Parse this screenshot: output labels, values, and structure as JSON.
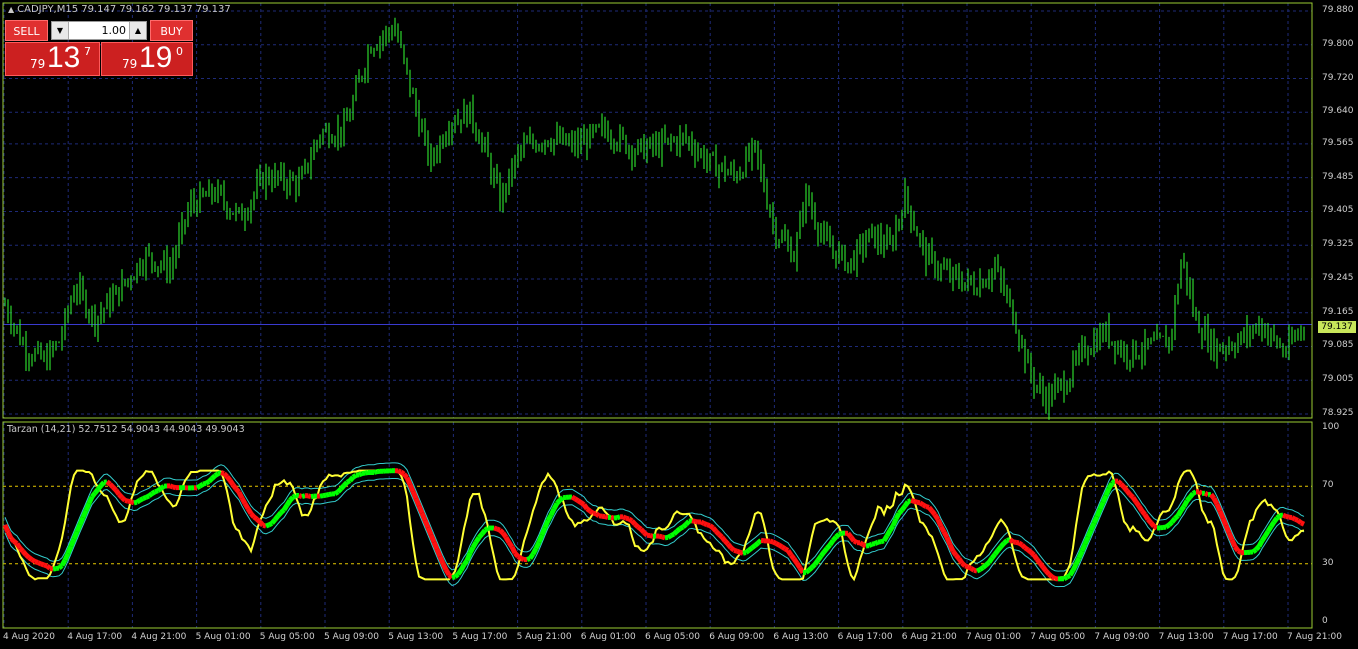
{
  "window": {
    "title": "CADJPY,M15  79.147 79.162 79.137 79.137"
  },
  "trade_panel": {
    "sell_label": "SELL",
    "buy_label": "BUY",
    "lot_value": "1.00",
    "bid_prefix": "79",
    "bid_big": "13",
    "bid_sup": "7",
    "ask_prefix": "79",
    "ask_big": "19",
    "ask_sup": "0"
  },
  "indicator": {
    "title": "Tarzan (14,21) 52.7512 54.9043 44.9043 49.9043"
  },
  "current_price": "79.137",
  "price_axis": [
    "79.880",
    "79.800",
    "79.720",
    "79.640",
    "79.565",
    "79.485",
    "79.405",
    "79.325",
    "79.245",
    "79.165",
    "79.085",
    "79.005",
    "78.925"
  ],
  "indicator_axis": [
    "100",
    "70",
    "30",
    "0"
  ],
  "time_axis": [
    "4 Aug 2020",
    "4 Aug 17:00",
    "4 Aug 21:00",
    "5 Aug 01:00",
    "5 Aug 05:00",
    "5 Aug 09:00",
    "5 Aug 13:00",
    "5 Aug 17:00",
    "5 Aug 21:00",
    "6 Aug 01:00",
    "6 Aug 05:00",
    "6 Aug 09:00",
    "6 Aug 13:00",
    "6 Aug 17:00",
    "6 Aug 21:00",
    "7 Aug 01:00",
    "7 Aug 05:00",
    "7 Aug 09:00",
    "7 Aug 13:00",
    "7 Aug 17:00",
    "7 Aug 21:00"
  ],
  "colors": {
    "candles": "#33ff33",
    "grid": "#1e2a78",
    "level_lines": "#e6c800",
    "axis_frame": "#9acd32",
    "signal_yellow": "#ffff33",
    "band_cyan": "#33cccc",
    "up_green": "#00ff00",
    "down_red": "#ff1010"
  },
  "chart_data": {
    "type": "line",
    "title": "CADJPY,M15",
    "ylim": [
      78.925,
      79.88
    ],
    "price_path": [
      [
        0,
        79.21
      ],
      [
        25,
        79.08
      ],
      [
        45,
        79.05
      ],
      [
        60,
        79.1
      ],
      [
        75,
        79.23
      ],
      [
        95,
        79.15
      ],
      [
        120,
        79.22
      ],
      [
        145,
        79.3
      ],
      [
        170,
        79.27
      ],
      [
        190,
        79.42
      ],
      [
        215,
        79.45
      ],
      [
        240,
        79.39
      ],
      [
        265,
        79.49
      ],
      [
        300,
        79.47
      ],
      [
        320,
        79.59
      ],
      [
        345,
        79.6
      ],
      [
        370,
        79.8
      ],
      [
        395,
        79.84
      ],
      [
        410,
        79.7
      ],
      [
        430,
        79.52
      ],
      [
        450,
        79.62
      ],
      [
        470,
        79.64
      ],
      [
        485,
        79.55
      ],
      [
        500,
        79.43
      ],
      [
        520,
        79.55
      ],
      [
        545,
        79.58
      ],
      [
        575,
        79.56
      ],
      [
        605,
        79.6
      ],
      [
        635,
        79.55
      ],
      [
        660,
        79.56
      ],
      [
        685,
        79.58
      ],
      [
        710,
        79.52
      ],
      [
        735,
        79.49
      ],
      [
        755,
        79.55
      ],
      [
        775,
        79.36
      ],
      [
        795,
        79.3
      ],
      [
        805,
        79.45
      ],
      [
        825,
        79.33
      ],
      [
        850,
        79.28
      ],
      [
        870,
        79.35
      ],
      [
        890,
        79.32
      ],
      [
        905,
        79.44
      ],
      [
        925,
        79.3
      ],
      [
        950,
        79.25
      ],
      [
        975,
        79.23
      ],
      [
        995,
        79.27
      ],
      [
        1015,
        79.15
      ],
      [
        1030,
        79.02
      ],
      [
        1045,
        78.96
      ],
      [
        1065,
        79.0
      ],
      [
        1085,
        79.08
      ],
      [
        1105,
        79.12
      ],
      [
        1125,
        79.07
      ],
      [
        1145,
        79.08
      ],
      [
        1170,
        79.1
      ],
      [
        1182,
        79.3
      ],
      [
        1195,
        79.15
      ],
      [
        1215,
        79.08
      ],
      [
        1240,
        79.1
      ],
      [
        1260,
        79.14
      ],
      [
        1285,
        79.07
      ],
      [
        1305,
        79.14
      ]
    ]
  }
}
